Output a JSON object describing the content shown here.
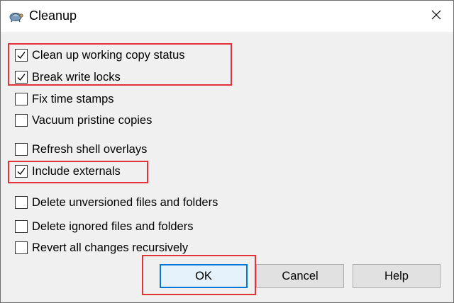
{
  "window": {
    "title": "Cleanup",
    "app_icon": "tortoise-icon",
    "close_icon": "close-icon"
  },
  "options": [
    {
      "label": "Clean up working copy status",
      "checked": true
    },
    {
      "label": "Break write locks",
      "checked": true
    },
    {
      "label": "Fix time stamps",
      "checked": false
    },
    {
      "label": "Vacuum pristine copies",
      "checked": false
    },
    {
      "label": "Refresh shell overlays",
      "checked": false
    },
    {
      "label": "Include externals",
      "checked": true
    },
    {
      "label": "Delete unversioned files and folders",
      "checked": false
    },
    {
      "label": "Delete ignored files and folders",
      "checked": false
    },
    {
      "label": "Revert all changes recursively",
      "checked": false
    }
  ],
  "buttons": {
    "ok": "OK",
    "cancel": "Cancel",
    "help": "Help"
  },
  "colors": {
    "highlight": "#e0343a",
    "default_button_border": "#0078d7",
    "dialog_background": "#f0f0f0"
  }
}
